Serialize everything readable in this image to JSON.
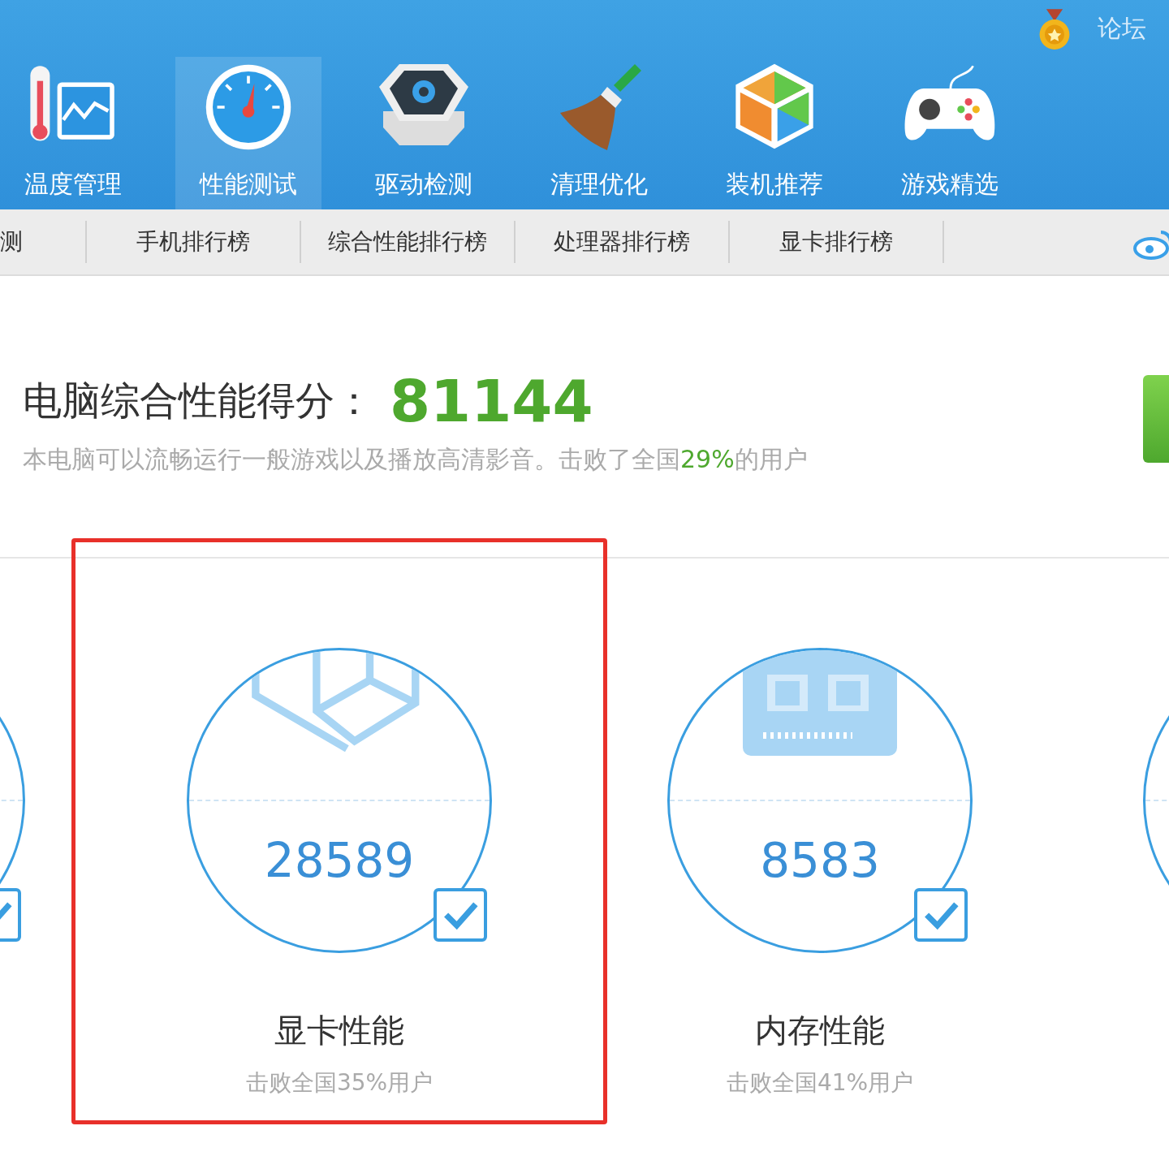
{
  "top_bar": {
    "forum_link": "论坛"
  },
  "nav": [
    {
      "label": "温度管理",
      "kind": "thermometer",
      "selected": false
    },
    {
      "label": "性能测试",
      "kind": "gauge",
      "selected": true
    },
    {
      "label": "驱动检测",
      "kind": "driver",
      "selected": false
    },
    {
      "label": "清理优化",
      "kind": "broom",
      "selected": false
    },
    {
      "label": "装机推荐",
      "kind": "cube",
      "selected": false
    },
    {
      "label": "游戏精选",
      "kind": "gamepad",
      "selected": false
    }
  ],
  "sub_nav": [
    "测",
    "手机排行榜",
    "综合性能排行榜",
    "处理器排行榜",
    "显卡排行榜"
  ],
  "score": {
    "label": "电脑综合性能得分：",
    "value": "81144",
    "description_before": "本电脑可以流畅运行一般游戏以及播放高清影音。击败了全国",
    "description_highlight": "29%",
    "description_after": "的用户"
  },
  "left_fragment": {
    "checked": true
  },
  "cards": [
    {
      "kind": "gpu",
      "score": "28589",
      "title": "显卡性能",
      "note": "击败全国35%用户",
      "checked": true,
      "highlighted": true
    },
    {
      "kind": "memory",
      "score": "8583",
      "title": "内存性能",
      "note": "击败全国41%用户",
      "checked": true,
      "highlighted": false
    }
  ]
}
